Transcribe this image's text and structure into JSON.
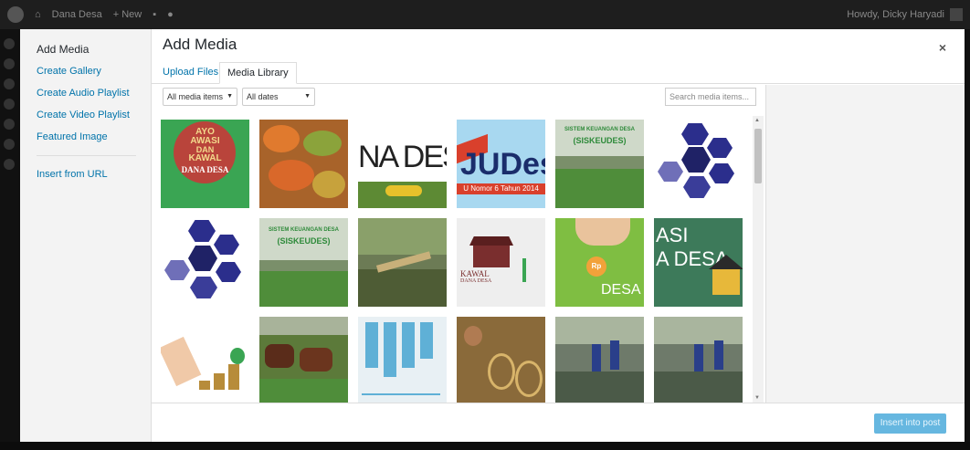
{
  "adminbar": {
    "site_name": "Dana Desa",
    "new_label": "New",
    "howdy": "Howdy, Dicky Haryadi"
  },
  "sidebar": {
    "items": [
      {
        "label": "Add Media"
      },
      {
        "label": "Create Gallery"
      },
      {
        "label": "Create Audio Playlist"
      },
      {
        "label": "Create Video Playlist"
      },
      {
        "label": "Featured Image"
      },
      {
        "label": "Insert from URL"
      }
    ]
  },
  "modal": {
    "title": "Add Media",
    "close": "×"
  },
  "tabs": {
    "upload": "Upload Files",
    "library": "Media Library"
  },
  "toolbar": {
    "filter_type": "All media items",
    "filter_date": "All dates",
    "search_placeholder": "Search media items..."
  },
  "tiles": {
    "t1_line1": "AYO",
    "t1_line2": "AWASI",
    "t1_line3": "DAN",
    "t1_line4": "KAWAL",
    "t1_line5": "DANA DESA",
    "t3_text": "NA DESA",
    "t4_text": "JUDes",
    "t4_sub": "U Nomor 6 Tahun 2014",
    "t5_line1": "SISTEM KEUANGAN DESA",
    "t5_line2": "(SISKEUDES)",
    "t8_line1": "SISTEM KEUANGAN DESA",
    "t8_line2": "(SISKEUDES)",
    "t10_line1": "KAWAL",
    "t10_line2": "DANA DESA",
    "t11_rp": "Rp",
    "t11_text": "DESA",
    "t12_line1": "ASI",
    "t12_line2": "A DESA"
  },
  "footer": {
    "insert_label": "Insert into post"
  },
  "colors": {
    "accent": "#0073aa",
    "insert_button": "#66b7e0"
  }
}
